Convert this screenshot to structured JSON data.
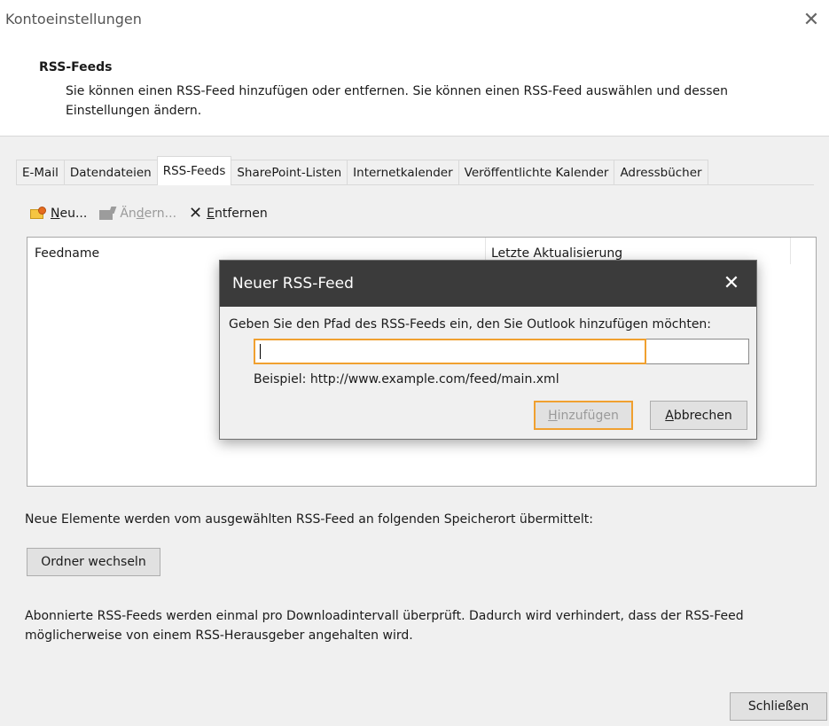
{
  "window": {
    "title": "Kontoeinstellungen",
    "close_icon": "close-icon"
  },
  "header": {
    "title": "RSS-Feeds",
    "description": "Sie können einen RSS-Feed hinzufügen oder entfernen. Sie können einen RSS-Feed auswählen und dessen Einstellungen ändern."
  },
  "tabs": [
    {
      "label": "E-Mail",
      "active": false
    },
    {
      "label": "Datendateien",
      "active": false
    },
    {
      "label": "RSS-Feeds",
      "active": true
    },
    {
      "label": "SharePoint-Listen",
      "active": false
    },
    {
      "label": "Internetkalender",
      "active": false
    },
    {
      "label": "Veröffentlichte Kalender",
      "active": false
    },
    {
      "label": "Adressbücher",
      "active": false
    }
  ],
  "toolbar": {
    "new_label_underlined": "N",
    "new_label_rest": "eu...",
    "new_icon": "rss-feed-icon",
    "edit_label_prefix": "Än",
    "edit_label_underlined": "d",
    "edit_label_rest": "ern...",
    "edit_icon": "edit-icon",
    "remove_label_underlined": "E",
    "remove_label_rest": "ntfernen",
    "remove_icon": "remove-x-icon"
  },
  "list": {
    "columns": [
      "Feedname",
      "Letzte Aktualisierung"
    ],
    "rows": []
  },
  "info_delivery": "Neue Elemente werden vom ausgewählten RSS-Feed an folgenden Speicherort übermittelt:",
  "change_folder_label": "Ordner wechseln",
  "info_subscription": "Abonnierte RSS-Feeds werden einmal pro Downloadintervall überprüft. Dadurch wird verhindert, dass der RSS-Feed möglicherweise von einem RSS-Herausgeber angehalten wird.",
  "close_label": "Schließen",
  "modal": {
    "title": "Neuer RSS-Feed",
    "prompt": "Geben Sie den Pfad des RSS-Feeds ein, den Sie Outlook hinzufügen möchten:",
    "input_value": "",
    "example": "Beispiel: http://www.example.com/feed/main.xml",
    "add_label_underlined": "H",
    "add_label_rest": "inzufügen",
    "cancel_label_underlined": "A",
    "cancel_label_rest": "bbrechen",
    "accent_color": "#f0a030"
  }
}
